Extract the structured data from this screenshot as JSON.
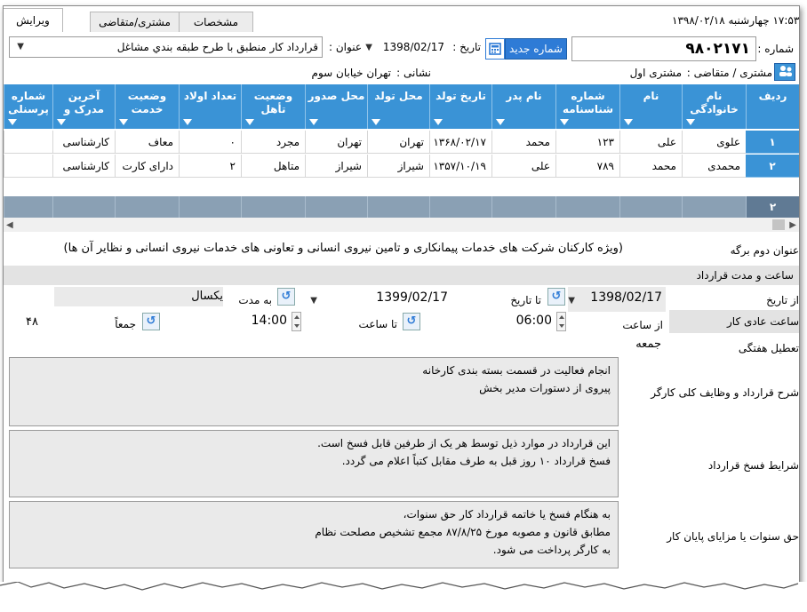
{
  "tabs": {
    "edit": "ویرایش",
    "customer": "مشتری/متقاضی",
    "specs": "مشخصات"
  },
  "clock": {
    "date": "۱۳۹۸/۰۲/۱۸",
    "weekday": "چهارشنبه",
    "time": "۱۷:۵۳"
  },
  "form": {
    "number_label": "شماره :",
    "number_value": "۹۸۰۲۱۷۱",
    "new_number_button": "شماره جدید",
    "date_label": "تاریخ :",
    "date_value": "1398/02/17",
    "title_label": "عنوان :",
    "title_value": "قرارداد کار منطبق با طرح طبقه بندي مشاغل",
    "customer_label": "مشتری / متقاضی :",
    "customer_value": "مشتری اول",
    "address_label": "نشانی :",
    "address_value": "تهران خیابان سوم"
  },
  "grid": {
    "columns": [
      "ردیف",
      "نام خانوادگی",
      "نام",
      "شماره شناسنامه",
      "نام پدر",
      "تاریخ تولد",
      "محل تولد",
      "محل صدور",
      "وضعیت تأهل",
      "تعداد اولاد",
      "وضعیت خدمت",
      "آخرین مدرک و",
      "شماره پرسنلی"
    ],
    "rows": [
      [
        "۱",
        "علوی",
        "علی",
        "۱۲۳",
        "محمد",
        "۱۳۶۸/۰۲/۱۷",
        "تهران",
        "تهران",
        "مجرد",
        "۰",
        "معاف",
        "کارشناسی",
        ""
      ],
      [
        "۲",
        "محمدی",
        "محمد",
        "۷۸۹",
        "علی",
        "۱۳۵۷/۱۰/۱۹",
        "شیراز",
        "شیراز",
        "متاهل",
        "۲",
        "دارای کارت",
        "کارشناسی",
        ""
      ]
    ],
    "footer_count": "۲"
  },
  "second_title": {
    "label": "عنوان دوم برگه",
    "value": "(ویژه کارکنان شرکت های خدمات پیمانکاری و تامین نیروی انسانی و تعاونی های خدمات نیروی انسانی و نظایر آن ها)"
  },
  "contract_time": {
    "section_label": "ساعت و مدت قرارداد",
    "from_date_label": "از تاریخ",
    "from_date_value": "1398/02/17",
    "to_date_label": "تا تاریخ",
    "to_date_value": "1399/02/17",
    "duration_label": "به مدت",
    "duration_value": "یکسال",
    "work_hours_label": "ساعت عادی کار",
    "from_hour_label": "از ساعت",
    "from_hour_value": "06:00",
    "to_hour_label": "تا ساعت",
    "to_hour_value": "14:00",
    "total_label": "جمعاً",
    "total_value": "۴۸",
    "weekly_holiday_label": "تعطیل هفتگی",
    "weekly_holiday_value": "جمعه"
  },
  "memos": {
    "duties_label": "شرح قرارداد و وظایف کلی کارگر",
    "duties_lines": [
      "انجام فعالیت در قسمت بسته بندی کارخانه",
      "پیروی از دستورات مدیر بخش"
    ],
    "termination_label": "شرایط فسخ قرارداد",
    "termination_lines": [
      "این قرارداد در موارد ذیل توسط هر یک از طرفین قابل فسخ است.",
      "فسخ قرارداد ۱۰ روز قبل به طرف مقابل کتباً اعلام می گردد."
    ],
    "severance_label": "حق سنوات یا مزایای پایان کار",
    "severance_lines": [
      "به هنگام فسخ یا خاتمه قرارداد کار حق سنوات،",
      "مطابق قانون و مصوبه مورخ ۸۷/۸/۲۵  مجمع تشخیص مصلحت نظام",
      "به کارگر پرداخت می شود."
    ]
  },
  "icons": {
    "calculator": "calculator-icon",
    "customer": "customer-icon",
    "refresh": "refresh-icon",
    "filter": "filter-icon"
  },
  "colors": {
    "header_blue": "#3a93d6",
    "button_blue": "#2e7bd6",
    "section_gray": "#e3e3e3"
  }
}
